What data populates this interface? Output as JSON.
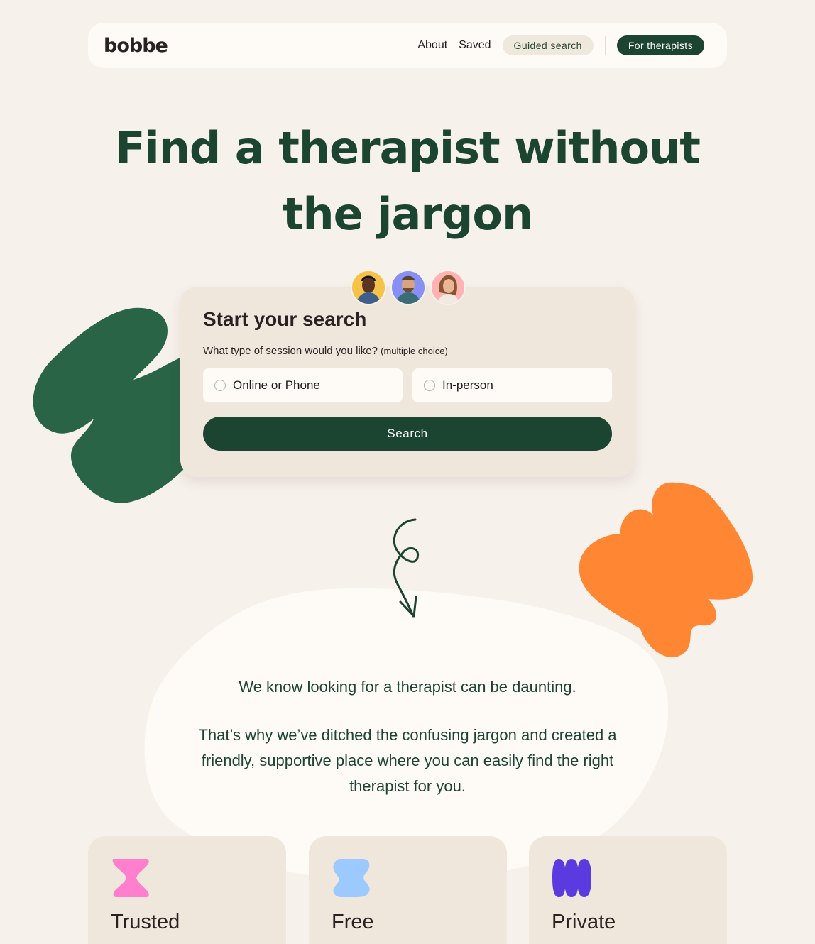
{
  "header": {
    "logo": "bobbe",
    "nav": {
      "about": "About",
      "saved": "Saved",
      "guided_search": "Guided search",
      "for_therapists": "For therapists"
    }
  },
  "hero": {
    "title_line1": "Find a therapist without",
    "title_line2": "the jargon"
  },
  "search_card": {
    "title": "Start your search",
    "question": "What type of session would you like?",
    "question_hint": "(multiple choice)",
    "options": [
      "Online or Phone",
      "In-person"
    ],
    "search_button": "Search"
  },
  "message": {
    "line1": "We know looking for a therapist can be daunting.",
    "line2": "That’s why we’ve ditched the confusing jargon and created a friendly, supportive place where you can easily find the right therapist for you."
  },
  "features": [
    {
      "label": "Trusted",
      "icon": "pink-hourglass-icon",
      "color": "#ff7fcf"
    },
    {
      "label": "Free",
      "icon": "blue-blob-icon",
      "color": "#9ccaff"
    },
    {
      "label": "Private",
      "icon": "purple-wave-icon",
      "color": "#5b3be0"
    }
  ],
  "colors": {
    "brand_green": "#1c4531",
    "leaf_green": "#2a6447",
    "orange": "#ff8733",
    "background": "#f7f1eb"
  }
}
